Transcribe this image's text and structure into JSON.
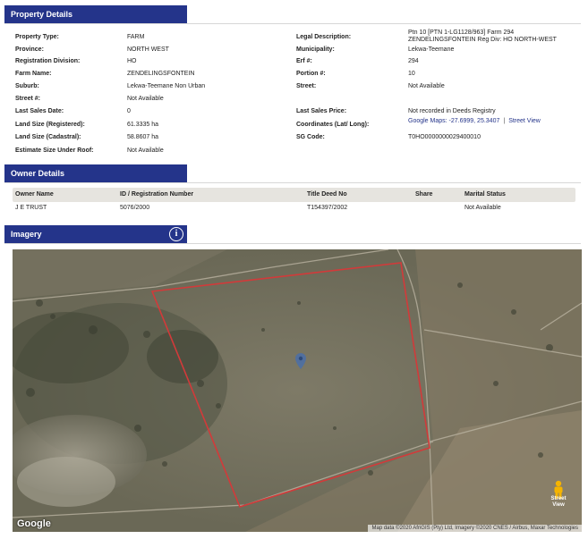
{
  "property_details": {
    "title": "Property Details",
    "left": [
      {
        "label": "Property Type:",
        "value": "FARM"
      },
      {
        "label": "Province:",
        "value": "NORTH WEST"
      },
      {
        "label": "Registration Division:",
        "value": "HO"
      },
      {
        "label": "Farm Name:",
        "value": "ZENDELINGSFONTEIN"
      },
      {
        "label": "Suburb:",
        "value": "Lekwa-Teemane Non Urban"
      },
      {
        "label": "Street #:",
        "value": "Not Available"
      },
      {
        "label": "Last Sales Date:",
        "value": "0"
      },
      {
        "label": "Land Size (Registered):",
        "value": "61.3335 ha"
      },
      {
        "label": "Land Size (Cadastral):",
        "value": "58.8607 ha"
      },
      {
        "label": "Estimate Size Under Roof:",
        "value": "Not Available"
      }
    ],
    "right": [
      {
        "label": "Legal Description:",
        "value": "Ptn 10 [PTN 1-LG1128/963] Farm 294 ZENDELINGSFONTEIN Reg Div: HO NORTH-WEST"
      },
      {
        "label": "Municipality:",
        "value": "Lekwa-Teemane"
      },
      {
        "label": "Erf #:",
        "value": "294"
      },
      {
        "label": "Portion #:",
        "value": "10"
      },
      {
        "label": "Street:",
        "value": "Not Available"
      },
      {
        "label": "Last Sales Price:",
        "value": "Not recorded in Deeds Registry"
      },
      {
        "label": "Coordinates (Lat/ Long):",
        "value": "Google Maps: -27.6999, 25.3407",
        "link": "Street View",
        "separator": "|"
      },
      {
        "label": "SG Code:",
        "value": "T0HO0000000029400010"
      }
    ]
  },
  "owner_details": {
    "title": "Owner Details",
    "columns": [
      "Owner Name",
      "ID / Registration Number",
      "Title Deed No",
      "Share",
      "Marital Status"
    ],
    "rows": [
      [
        "J E TRUST",
        "5076/2000",
        "T154397/2002",
        "",
        "Not Available"
      ]
    ]
  },
  "imagery": {
    "title": "Imagery",
    "info_icon": "i",
    "google_logo": "Google",
    "attribution": "Map data ©2020 AfriGIS (Pty) Ltd, Imagery ©2020 CNES / Airbus, Maxar Technologies",
    "street_view_label": "Street View",
    "boundary_color": "#d23a3a",
    "header_color": "#24348a"
  }
}
